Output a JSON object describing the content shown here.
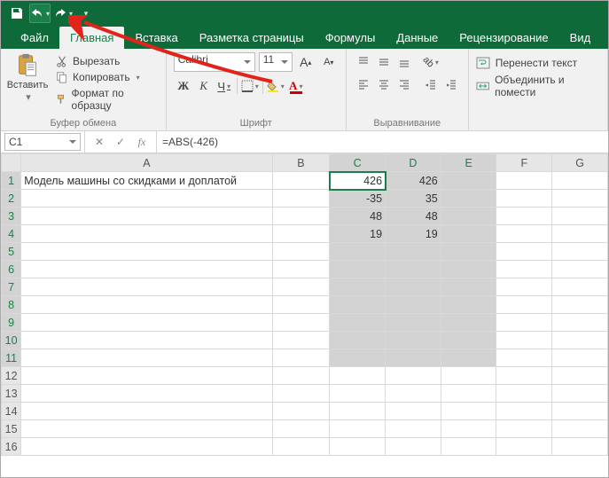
{
  "qat": {
    "save": "save-icon",
    "undo": "undo-icon",
    "redo": "redo-icon"
  },
  "tabs": {
    "file": "Файл",
    "home": "Главная",
    "insert": "Вставка",
    "layout": "Разметка страницы",
    "formulas": "Формулы",
    "data": "Данные",
    "review": "Рецензирование",
    "view": "Вид"
  },
  "ribbon": {
    "clipboard": {
      "paste": "Вставить",
      "cut": "Вырезать",
      "copy": "Копировать",
      "format_painter": "Формат по образцу",
      "group": "Буфер обмена"
    },
    "font": {
      "name": "Calibri",
      "size": "11",
      "group": "Шрифт",
      "bold": "Ж",
      "italic": "К",
      "underline": "Ч",
      "grow": "A",
      "shrink": "A"
    },
    "alignment": {
      "group": "Выравнивание",
      "wrap": "Перенести текст",
      "merge": "Объединить и помести"
    }
  },
  "namebox": "C1",
  "formula": "=ABS(-426)",
  "columns": [
    "A",
    "B",
    "C",
    "D",
    "E",
    "F",
    "G"
  ],
  "rows": [
    "1",
    "2",
    "3",
    "4",
    "5",
    "6",
    "7",
    "8",
    "9",
    "10",
    "11",
    "12",
    "13",
    "14",
    "15",
    "16"
  ],
  "cells": {
    "A1": "Модель машины со скидками и доплатой",
    "C1": "426",
    "D1": "426",
    "C2": "-35",
    "D2": "35",
    "C3": "48",
    "D3": "48",
    "C4": "19",
    "D4": "19"
  },
  "selection": {
    "from": "C1",
    "to": "E11",
    "active": "C1"
  }
}
